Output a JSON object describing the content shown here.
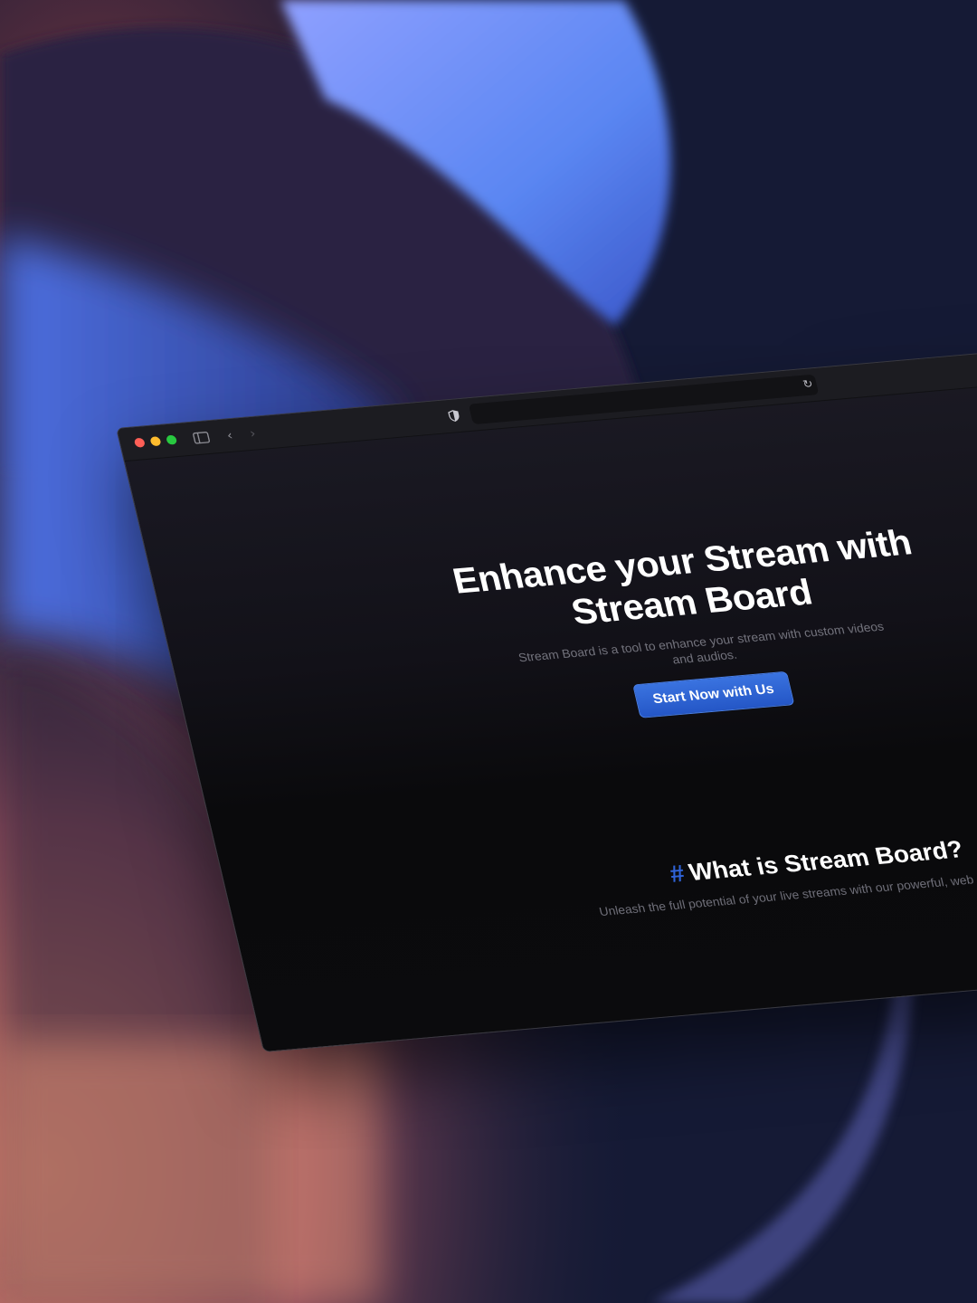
{
  "colors": {
    "accent": "#2f63d8",
    "button_bg": "#2a5fd0",
    "page_bg": "#0b0b0d",
    "toolbar_bg": "#1c1c21"
  },
  "toolbar": {
    "traffic_lights": [
      "close",
      "minimize",
      "zoom"
    ],
    "icons": {
      "sidebar": "sidebar-icon",
      "back": "chevron-left-icon",
      "forward": "chevron-right-icon",
      "privacy": "shield-icon",
      "reload": "reload-icon"
    },
    "address_value": ""
  },
  "hero": {
    "title": "Enhance your Stream with Stream Board",
    "subtitle": "Stream Board is a tool to enhance your stream with custom videos and audios.",
    "cta_label": "Start Now with Us"
  },
  "section": {
    "hash": "#",
    "title": "What is Stream Board?",
    "subtitle": "Unleash the full potential of your live streams with our powerful, web stream deck!"
  }
}
